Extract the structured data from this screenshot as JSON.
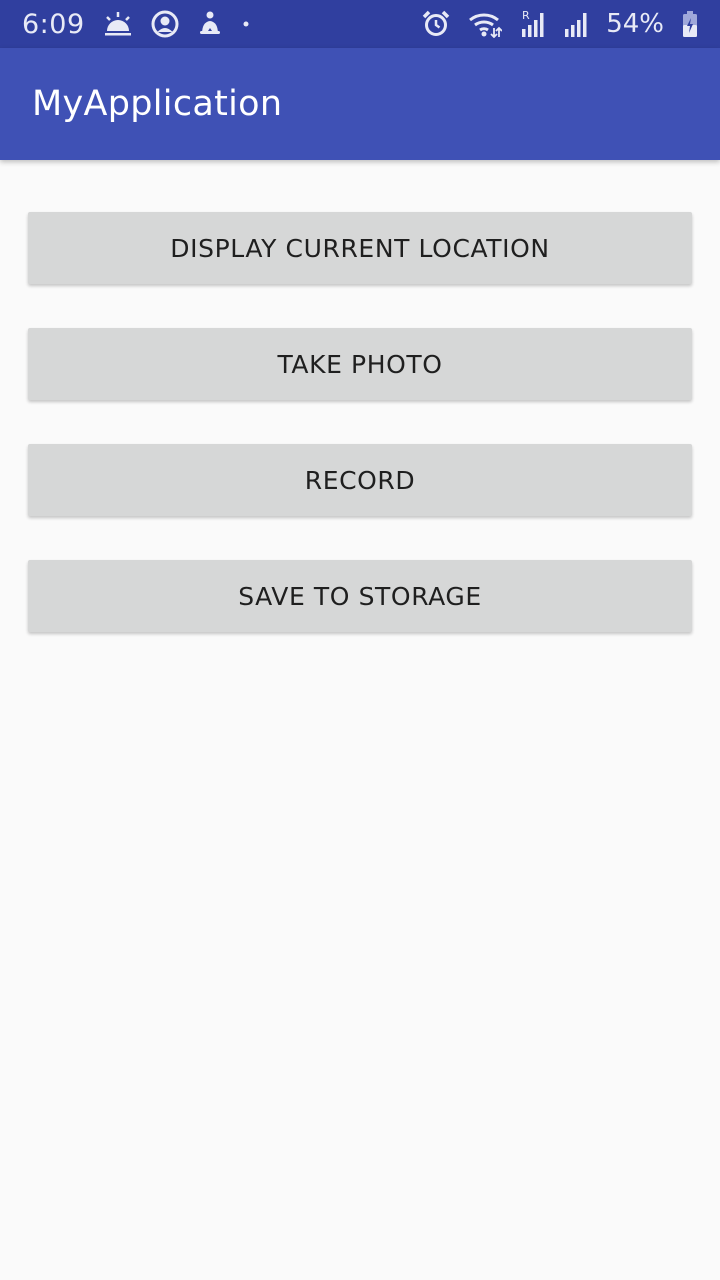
{
  "status_bar": {
    "time": "6:09",
    "battery_percent": "54%",
    "icons_left": [
      "weather-sunrise-icon",
      "account-circle-icon",
      "accessibility-icon",
      "notification-dot-icon"
    ],
    "icons_right": [
      "alarm-icon",
      "wifi-icon",
      "signal-roaming-icon",
      "signal-icon",
      "battery-charging-icon"
    ],
    "colors": {
      "background": "#303f9f",
      "foreground": "#e8eaf6"
    }
  },
  "app_bar": {
    "title": "MyApplication",
    "color": "#3f51b5"
  },
  "buttons": [
    {
      "label": "DISPLAY CURRENT LOCATION"
    },
    {
      "label": "TAKE PHOTO"
    },
    {
      "label": "RECORD"
    },
    {
      "label": "SAVE TO STORAGE"
    }
  ]
}
